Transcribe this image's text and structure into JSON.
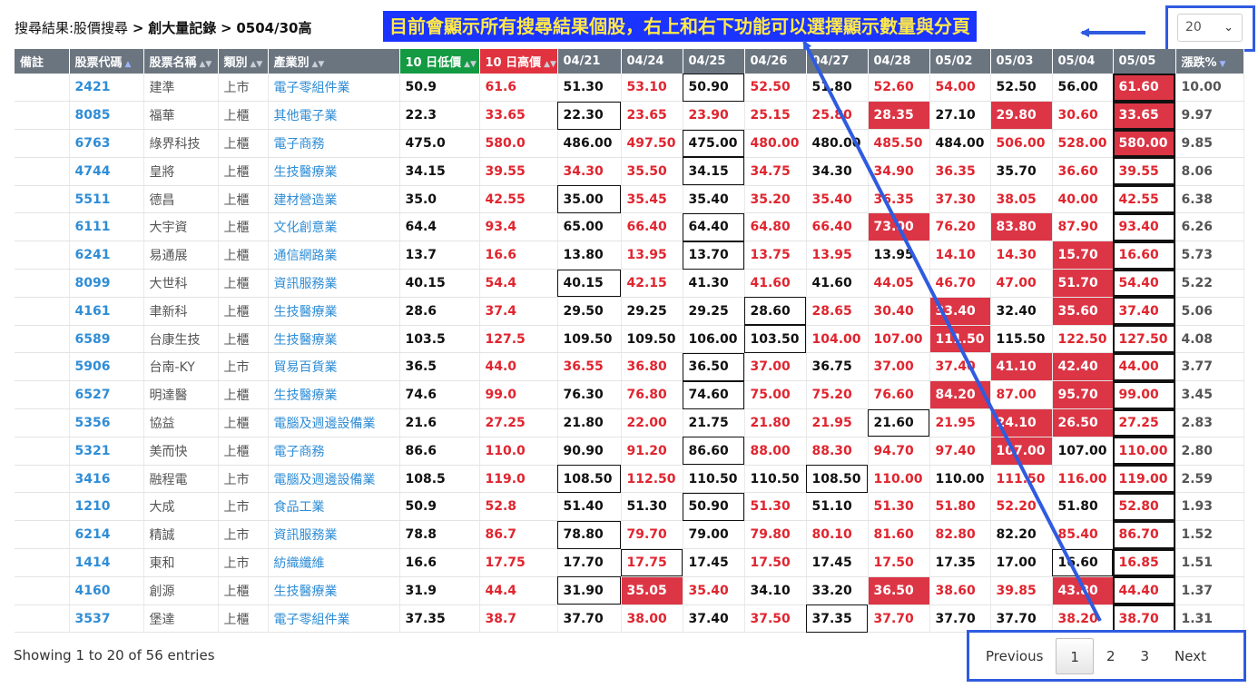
{
  "breadcrumb": {
    "prefix": "搜尋結果:股價搜尋",
    "sep": ">",
    "level2": "創大量記錄",
    "level3": "0504/30高"
  },
  "annotation": {
    "banner": "目前會顯示所有搜尋結果個股，右上和右下功能可以選擇顯示數量與分頁",
    "color": "#1a33ff",
    "text_color": "#ffe94a"
  },
  "length_select": {
    "value": "20",
    "icon": "chevron-down-icon"
  },
  "table": {
    "headers": [
      "備註",
      "股票代碼",
      "股票名稱",
      "類別",
      "產業別",
      "10 日低價",
      "10 日高價",
      "04/21",
      "04/24",
      "04/25",
      "04/26",
      "04/27",
      "04/28",
      "05/02",
      "05/03",
      "05/04",
      "05/05",
      "漲跌%"
    ],
    "rows": [
      {
        "note": "",
        "code": "2421",
        "name": "建準",
        "market": "上市",
        "industry": "電子零組件業",
        "low": "50.9",
        "high": "61.6",
        "prices": [
          "51.30",
          "53.10",
          "50.90",
          "52.50",
          "51.80",
          "52.60",
          "54.00",
          "52.50",
          "56.00",
          "61.60"
        ],
        "pct": "10.00"
      },
      {
        "note": "",
        "code": "8085",
        "name": "福華",
        "market": "上櫃",
        "industry": "其他電子業",
        "low": "22.3",
        "high": "33.65",
        "prices": [
          "22.30",
          "23.65",
          "23.90",
          "25.15",
          "25.80",
          "28.35",
          "27.10",
          "29.80",
          "30.60",
          "33.65"
        ],
        "pct": "9.97"
      },
      {
        "note": "",
        "code": "6763",
        "name": "綠界科技",
        "market": "上櫃",
        "industry": "電子商務",
        "low": "475.0",
        "high": "580.0",
        "prices": [
          "486.00",
          "497.50",
          "475.00",
          "480.00",
          "480.00",
          "485.50",
          "484.00",
          "506.00",
          "528.00",
          "580.00"
        ],
        "pct": "9.85"
      },
      {
        "note": "",
        "code": "4744",
        "name": "皇將",
        "market": "上櫃",
        "industry": "生技醫療業",
        "low": "34.15",
        "high": "39.55",
        "prices": [
          "34.30",
          "35.50",
          "34.15",
          "34.75",
          "34.30",
          "34.90",
          "36.35",
          "35.70",
          "36.60",
          "39.55"
        ],
        "pct": "8.06"
      },
      {
        "note": "",
        "code": "5511",
        "name": "德昌",
        "market": "上櫃",
        "industry": "建材營造業",
        "low": "35.0",
        "high": "42.55",
        "prices": [
          "35.00",
          "35.45",
          "35.40",
          "35.20",
          "35.40",
          "36.35",
          "37.30",
          "38.05",
          "40.00",
          "42.55"
        ],
        "pct": "6.38"
      },
      {
        "note": "",
        "code": "6111",
        "name": "大宇資",
        "market": "上櫃",
        "industry": "文化創意業",
        "low": "64.4",
        "high": "93.4",
        "prices": [
          "65.00",
          "66.40",
          "64.40",
          "64.80",
          "66.40",
          "73.00",
          "76.20",
          "83.80",
          "87.90",
          "93.40"
        ],
        "pct": "6.26"
      },
      {
        "note": "",
        "code": "6241",
        "name": "易通展",
        "market": "上櫃",
        "industry": "通信網路業",
        "low": "13.7",
        "high": "16.6",
        "prices": [
          "13.80",
          "13.95",
          "13.70",
          "13.75",
          "13.95",
          "13.95",
          "14.10",
          "14.30",
          "15.70",
          "16.60"
        ],
        "pct": "5.73"
      },
      {
        "note": "",
        "code": "8099",
        "name": "大世科",
        "market": "上櫃",
        "industry": "資訊服務業",
        "low": "40.15",
        "high": "54.4",
        "prices": [
          "40.15",
          "42.15",
          "41.30",
          "41.60",
          "41.60",
          "44.05",
          "46.70",
          "47.00",
          "51.70",
          "54.40"
        ],
        "pct": "5.22"
      },
      {
        "note": "",
        "code": "4161",
        "name": "聿新科",
        "market": "上櫃",
        "industry": "生技醫療業",
        "low": "28.6",
        "high": "37.4",
        "prices": [
          "29.50",
          "29.25",
          "29.25",
          "28.60",
          "28.65",
          "30.40",
          "33.40",
          "32.40",
          "35.60",
          "37.40"
        ],
        "pct": "5.06"
      },
      {
        "note": "",
        "code": "6589",
        "name": "台康生技",
        "market": "上櫃",
        "industry": "生技醫療業",
        "low": "103.5",
        "high": "127.5",
        "prices": [
          "109.50",
          "109.50",
          "106.00",
          "103.50",
          "104.00",
          "107.00",
          "111.50",
          "115.50",
          "122.50",
          "127.50"
        ],
        "pct": "4.08"
      },
      {
        "note": "",
        "code": "5906",
        "name": "台南-KY",
        "market": "上市",
        "industry": "貿易百貨業",
        "low": "36.5",
        "high": "44.0",
        "prices": [
          "36.55",
          "36.80",
          "36.50",
          "37.00",
          "36.75",
          "37.00",
          "37.40",
          "41.10",
          "42.40",
          "44.00"
        ],
        "pct": "3.77"
      },
      {
        "note": "",
        "code": "6527",
        "name": "明達醫",
        "market": "上櫃",
        "industry": "生技醫療業",
        "low": "74.6",
        "high": "99.0",
        "prices": [
          "76.30",
          "76.80",
          "74.60",
          "75.00",
          "75.20",
          "76.60",
          "84.20",
          "87.00",
          "95.70",
          "99.00"
        ],
        "pct": "3.45"
      },
      {
        "note": "",
        "code": "5356",
        "name": "協益",
        "market": "上櫃",
        "industry": "電腦及週邊設備業",
        "low": "21.6",
        "high": "27.25",
        "prices": [
          "21.80",
          "22.00",
          "21.75",
          "21.80",
          "21.95",
          "21.60",
          "21.95",
          "24.10",
          "26.50",
          "27.25"
        ],
        "pct": "2.83"
      },
      {
        "note": "",
        "code": "5321",
        "name": "美而快",
        "market": "上櫃",
        "industry": "電子商務",
        "low": "86.6",
        "high": "110.0",
        "prices": [
          "90.90",
          "91.20",
          "86.60",
          "88.00",
          "88.30",
          "94.70",
          "97.40",
          "107.00",
          "107.00",
          "110.00"
        ],
        "pct": "2.80"
      },
      {
        "note": "",
        "code": "3416",
        "name": "融程電",
        "market": "上市",
        "industry": "電腦及週邊設備業",
        "low": "108.5",
        "high": "119.0",
        "prices": [
          "108.50",
          "112.50",
          "110.50",
          "110.50",
          "108.50",
          "110.00",
          "110.00",
          "111.50",
          "116.00",
          "119.00"
        ],
        "pct": "2.59"
      },
      {
        "note": "",
        "code": "1210",
        "name": "大成",
        "market": "上市",
        "industry": "食品工業",
        "low": "50.9",
        "high": "52.8",
        "prices": [
          "51.40",
          "51.30",
          "50.90",
          "51.30",
          "51.10",
          "51.30",
          "51.80",
          "52.20",
          "51.80",
          "52.80"
        ],
        "pct": "1.93"
      },
      {
        "note": "",
        "code": "6214",
        "name": "精誠",
        "market": "上市",
        "industry": "資訊服務業",
        "low": "78.8",
        "high": "86.7",
        "prices": [
          "78.80",
          "79.70",
          "79.00",
          "79.80",
          "80.10",
          "81.60",
          "82.80",
          "82.20",
          "85.40",
          "86.70"
        ],
        "pct": "1.52"
      },
      {
        "note": "",
        "code": "1414",
        "name": "東和",
        "market": "上市",
        "industry": "紡織纖維",
        "low": "16.6",
        "high": "17.75",
        "prices": [
          "17.70",
          "17.75",
          "17.45",
          "17.50",
          "17.45",
          "17.50",
          "17.35",
          "17.00",
          "16.60",
          "16.85"
        ],
        "pct": "1.51"
      },
      {
        "note": "",
        "code": "4160",
        "name": "創源",
        "market": "上櫃",
        "industry": "生技醫療業",
        "low": "31.9",
        "high": "44.4",
        "prices": [
          "31.90",
          "35.05",
          "35.40",
          "34.10",
          "33.20",
          "36.50",
          "38.60",
          "39.85",
          "43.80",
          "44.40"
        ],
        "pct": "1.37"
      },
      {
        "note": "",
        "code": "3537",
        "name": "堡達",
        "market": "上櫃",
        "industry": "電子零組件業",
        "low": "37.35",
        "high": "38.7",
        "prices": [
          "37.70",
          "38.00",
          "37.40",
          "37.50",
          "37.35",
          "37.70",
          "37.70",
          "37.70",
          "38.20",
          "38.70"
        ],
        "pct": "1.31"
      }
    ],
    "styles": {
      "up": [
        [
          1,
          3,
          5,
          6,
          9
        ],
        [
          1,
          2,
          3,
          4,
          5,
          7,
          8,
          9
        ],
        [
          1,
          3,
          5,
          7,
          8,
          9
        ],
        [
          0,
          1,
          3,
          5,
          6,
          8,
          9
        ],
        [
          1,
          3,
          4,
          5,
          6,
          7,
          8,
          9
        ],
        [
          1,
          3,
          4,
          5,
          6,
          7,
          8,
          9
        ],
        [
          1,
          3,
          4,
          6,
          7,
          8,
          9
        ],
        [
          1,
          3,
          5,
          6,
          7,
          8,
          9
        ],
        [
          4,
          5,
          6,
          8,
          9
        ],
        [
          4,
          5,
          6,
          8,
          9
        ],
        [
          0,
          1,
          3,
          5,
          6,
          7,
          8,
          9
        ],
        [
          1,
          3,
          4,
          5,
          6,
          7,
          8,
          9
        ],
        [
          1,
          3,
          4,
          6,
          7,
          8,
          9
        ],
        [
          1,
          3,
          4,
          5,
          6,
          7,
          9
        ],
        [
          1,
          5,
          7,
          8,
          9
        ],
        [
          3,
          5,
          6,
          7,
          9
        ],
        [
          1,
          3,
          4,
          5,
          6,
          8,
          9
        ],
        [
          1,
          3,
          5,
          9
        ],
        [
          1,
          2,
          5,
          6,
          7,
          8,
          9
        ],
        [
          1,
          3,
          5,
          8,
          9
        ]
      ],
      "hl": [
        [
          9
        ],
        [
          5,
          7,
          9
        ],
        [
          9
        ],
        [],
        [],
        [
          5,
          7
        ],
        [
          8
        ],
        [
          8
        ],
        [
          6,
          8
        ],
        [
          6
        ],
        [
          7,
          8
        ],
        [
          6,
          8
        ],
        [
          7,
          8
        ],
        [
          7
        ],
        [],
        [],
        [],
        [],
        [
          1,
          5,
          8
        ],
        []
      ],
      "box": [
        [
          2
        ],
        [
          0
        ],
        [
          2
        ],
        [
          2
        ],
        [
          0
        ],
        [
          2
        ],
        [
          2
        ],
        [
          0
        ],
        [
          3
        ],
        [
          3
        ],
        [
          2
        ],
        [
          2
        ],
        [
          5
        ],
        [
          2
        ],
        [
          0,
          4
        ],
        [
          2
        ],
        [
          0
        ],
        [
          1,
          8
        ],
        [
          0
        ],
        [
          4
        ]
      ]
    }
  },
  "info": "Showing 1 to 20 of 56 entries",
  "pagination": {
    "previous": "Previous",
    "pages": [
      "1",
      "2",
      "3"
    ],
    "current": "1",
    "next": "Next"
  }
}
